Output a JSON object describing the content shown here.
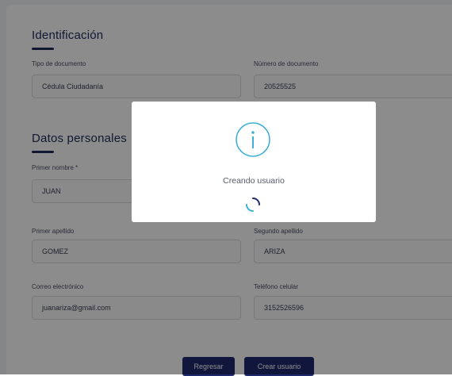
{
  "identification": {
    "title": "Identificación",
    "doc_type_label": "Tipo de documento",
    "doc_type_value": "Cédula Ciudadanía",
    "doc_number_label": "Número de documento",
    "doc_number_value": "20525525"
  },
  "personal": {
    "title": "Datos personales",
    "first_name_label": "Primer nombre *",
    "first_name_value": "JUAN",
    "first_surname_label": "Primer apellido",
    "first_surname_value": "GOMEZ",
    "second_surname_label": "Segundo apellido",
    "second_surname_value": "ARIZA",
    "email_label": "Correo electrónico",
    "email_value": "juanariza@gmail.com",
    "phone_label": "Teléfono celular",
    "phone_value": "3152526596"
  },
  "buttons": {
    "back_label": "Regresar",
    "create_label": "Crear usuario"
  },
  "modal": {
    "icon": "info-icon",
    "message": "Creando usuario",
    "spinner": "loading-spinner"
  },
  "colors": {
    "primary": "#1f2a6e",
    "icon_accent": "#3fb0d8",
    "overlay": "rgba(0,0,0,0.45)"
  }
}
